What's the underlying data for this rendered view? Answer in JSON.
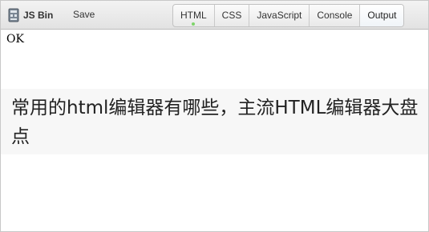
{
  "toolbar": {
    "brand_name": "JS Bin",
    "logo_icon": "jsbin-logo-icon",
    "save_label": "Save",
    "tabs": [
      {
        "label": "HTML",
        "active": true
      },
      {
        "label": "CSS",
        "active": false
      },
      {
        "label": "JavaScript",
        "active": false
      },
      {
        "label": "Console",
        "active": false
      },
      {
        "label": "Output",
        "active": true
      }
    ]
  },
  "output": {
    "ok_text": "OK",
    "headline": "常用的html编辑器有哪些，主流HTML编辑器大盘点"
  },
  "colors": {
    "toolbar_bg": "#e8e8e8",
    "active_indicator": "#7fd46b",
    "headline_bg": "#f7f7f7"
  }
}
